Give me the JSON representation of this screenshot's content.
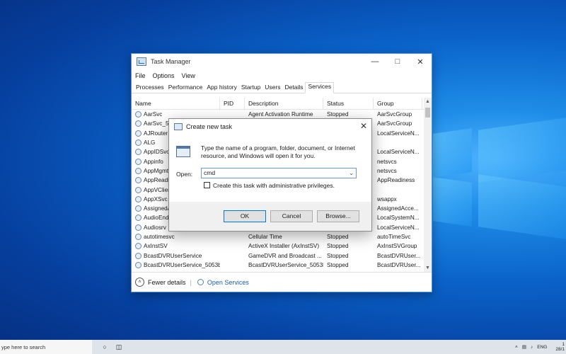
{
  "task_manager": {
    "title": "Task Manager",
    "menu": [
      "File",
      "Options",
      "View"
    ],
    "tabs": [
      "Processes",
      "Performance",
      "App history",
      "Startup",
      "Users",
      "Details",
      "Services"
    ],
    "active_tab": "Services",
    "columns": [
      "Name",
      "PID",
      "Description",
      "Status",
      "Group"
    ],
    "rows": [
      [
        "AarSvc",
        "",
        "Agent Activation Runtime",
        "Stopped",
        "AarSvcGroup"
      ],
      [
        "AarSvc_50",
        "",
        "",
        "",
        "AarSvcGroup"
      ],
      [
        "AJRouter",
        "",
        "",
        "",
        "LocalServiceN..."
      ],
      [
        "ALG",
        "",
        "",
        "",
        ""
      ],
      [
        "AppIDSvc",
        "",
        "",
        "",
        "LocalServiceN..."
      ],
      [
        "Appinfo",
        "",
        "",
        "",
        "netsvcs"
      ],
      [
        "AppMgmt",
        "",
        "",
        "",
        "netsvcs"
      ],
      [
        "AppReadin",
        "",
        "",
        "",
        "AppReadiness"
      ],
      [
        "AppVClien",
        "",
        "",
        "",
        ""
      ],
      [
        "AppXSvc",
        "",
        "",
        "",
        "wsappx"
      ],
      [
        "AssignedA",
        "",
        "",
        "",
        "AssignedAcce..."
      ],
      [
        "AudioEnd",
        "",
        "",
        "",
        "LocalSystemN..."
      ],
      [
        "Audiosrv",
        "",
        "",
        "",
        "LocalServiceN..."
      ],
      [
        "autotimesvc",
        "",
        "Cellular Time",
        "Stopped",
        "autoTimeSvc"
      ],
      [
        "AxInstSV",
        "",
        "ActiveX Installer (AxInstSV)",
        "Stopped",
        "AxInstSVGroup"
      ],
      [
        "BcastDVRUserService",
        "",
        "GameDVR and Broadcast ...",
        "Stopped",
        "BcastDVRUser..."
      ],
      [
        "BcastDVRUserService_5053b",
        "",
        "BcastDVRUserService_5053b",
        "Stopped",
        "BcastDVRUser..."
      ]
    ],
    "fewer_details": "Fewer details",
    "open_services": "Open Services"
  },
  "dialog": {
    "title": "Create new task",
    "description": "Type the name of a program, folder, document, or Internet resource, and Windows will open it for you.",
    "open_label": "Open:",
    "open_value": "cmd",
    "admin_checkbox": "Create this task with administrative privileges.",
    "ok": "OK",
    "cancel": "Cancel",
    "browse": "Browse..."
  },
  "taskbar": {
    "search_placeholder": "ype here to search",
    "lang": "ENG",
    "clock_line1": "1",
    "clock_line2": "28/1"
  }
}
